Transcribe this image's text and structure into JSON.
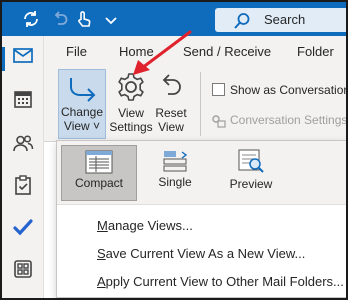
{
  "titlebar": {
    "search_label": "Search",
    "accent_color": "#0f6cbd"
  },
  "qat": [
    {
      "icon": "sync-icon"
    },
    {
      "icon": "undo-icon"
    },
    {
      "icon": "touch-mode-icon"
    },
    {
      "icon": "customize-qat-chevron-icon"
    }
  ],
  "rail": [
    {
      "icon": "mail-icon",
      "active": true
    },
    {
      "icon": "calendar-icon"
    },
    {
      "icon": "people-icon"
    },
    {
      "icon": "tasks-icon"
    },
    {
      "icon": "todo-check-icon"
    },
    {
      "icon": "apps-icon"
    }
  ],
  "tabs": [
    "File",
    "Home",
    "Send / Receive",
    "Folder"
  ],
  "ribbon": {
    "change_view": {
      "line1": "Change",
      "line2": "View ˅"
    },
    "view_settings": {
      "line1": "View",
      "line2": "Settings"
    },
    "reset_view": {
      "line1": "Reset",
      "line2": "View"
    },
    "show_as_conversations": "Show as Conversations",
    "conversation_settings": "Conversation Settings"
  },
  "gallery": [
    {
      "label": "Compact",
      "icon": "compact-view-icon",
      "selected": true
    },
    {
      "label": "Single",
      "icon": "single-view-icon",
      "selected": false
    },
    {
      "label": "Preview",
      "icon": "preview-view-icon",
      "selected": false
    }
  ],
  "menu": {
    "manage_views": {
      "key": "M",
      "rest": "anage Views..."
    },
    "save_current_view": {
      "key": "S",
      "rest": "ave Current View As a New View..."
    },
    "apply_current_view": {
      "key": "A",
      "rest": "pply Current View to Other Mail Folders..."
    }
  },
  "annotation": {
    "color": "#e0222d"
  }
}
